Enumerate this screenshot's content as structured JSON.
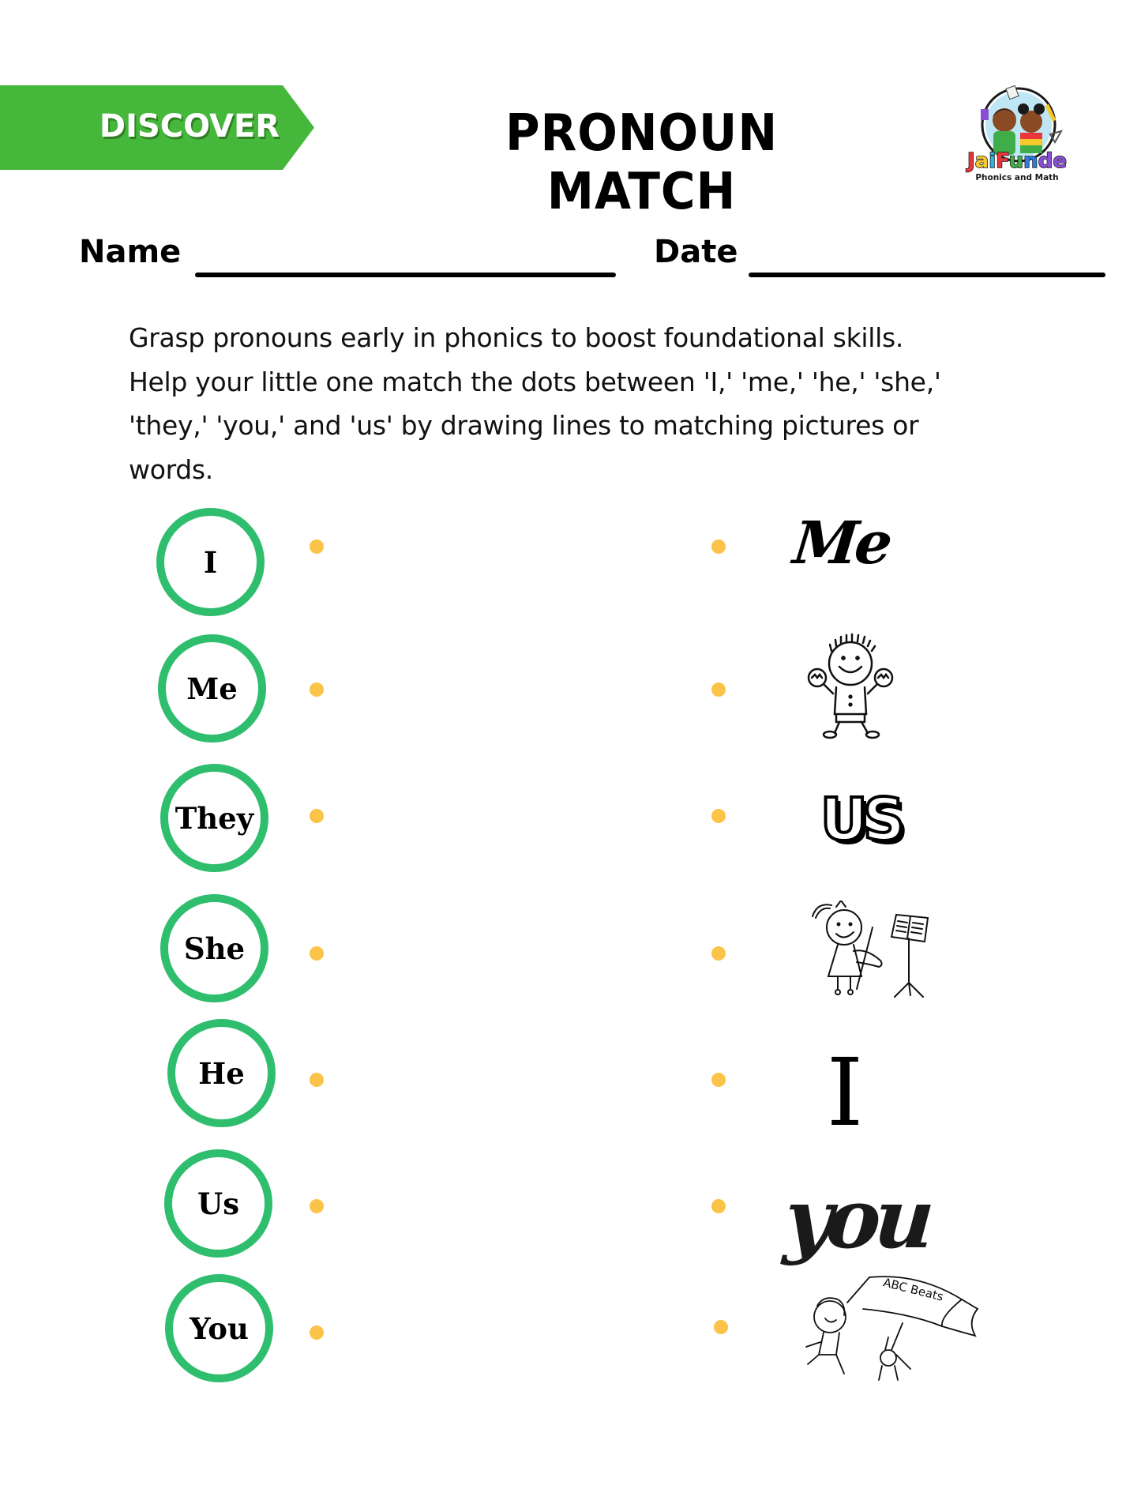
{
  "header": {
    "banner_label": "DISCOVER",
    "title": "PRONOUN MATCH",
    "logo": {
      "name": "JaiFunde",
      "tagline": "Phonics and Math",
      "name_letter_colors": [
        "#e8363b",
        "#f7c82b",
        "#2db3e6",
        "#e8363b",
        "#3fae49",
        "#2d7be0",
        "#8a4ed6",
        "#f48a1f"
      ]
    }
  },
  "fields": {
    "name_label": "Name",
    "date_label": "Date"
  },
  "instructions": {
    "lines": [
      "Grasp pronouns early in phonics to boost foundational skills.",
      "Help your little one match the dots between 'I,' 'me,' 'he,' 'she,'",
      "'they,' 'you,' and 'us' by drawing lines to matching pictures or",
      "words."
    ]
  },
  "left_column": {
    "pronouns": [
      "I",
      "Me",
      "They",
      "She",
      "He",
      "Us",
      "You"
    ]
  },
  "right_column": {
    "answers": [
      {
        "type": "word",
        "style": "handwritten",
        "text": "Me"
      },
      {
        "type": "picture",
        "icon": "boy-with-maracas-icon"
      },
      {
        "type": "word",
        "style": "bubble-outline",
        "text": "US"
      },
      {
        "type": "picture",
        "icon": "girl-playing-violin-icon"
      },
      {
        "type": "word",
        "style": "serif",
        "text": "I"
      },
      {
        "type": "word",
        "style": "brush-script",
        "text": "you"
      },
      {
        "type": "picture",
        "icon": "children-with-banner-icon",
        "banner_text": "ABC Beats"
      }
    ]
  },
  "colors": {
    "banner_green": "#45b83b",
    "circle_green": "#2fbd6e",
    "dot_yellow": "#fbc347",
    "text": "#000000"
  }
}
